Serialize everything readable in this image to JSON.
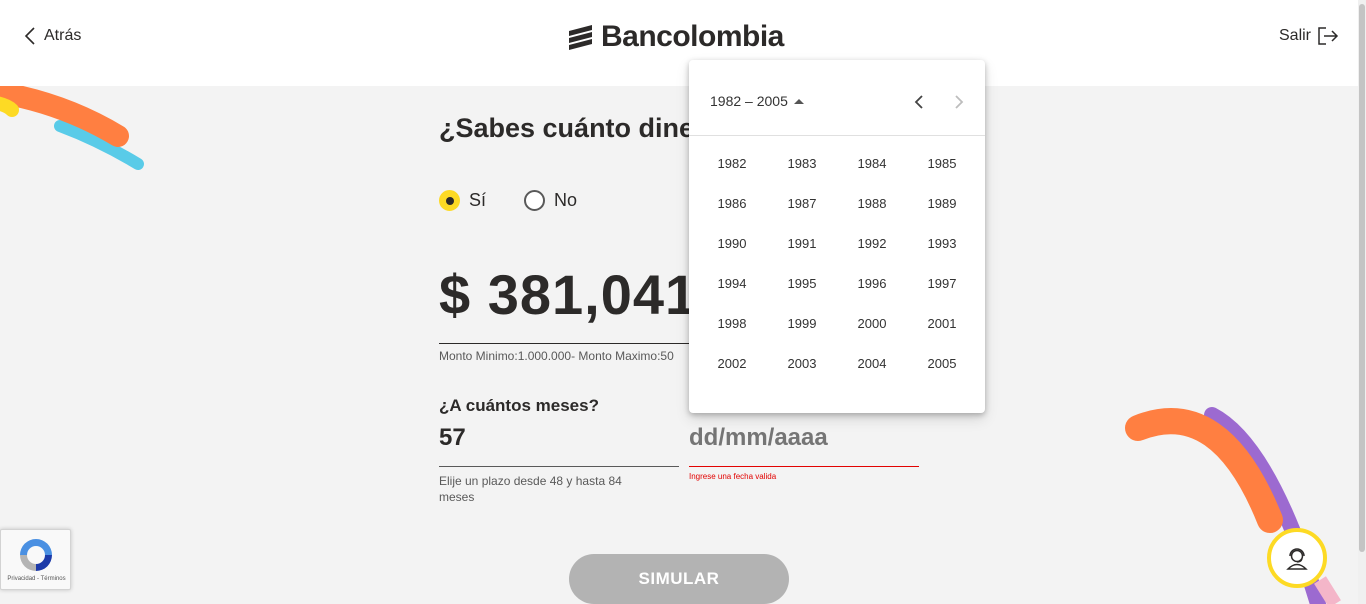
{
  "header": {
    "back_label": "Atrás",
    "brand": "Bancolombia",
    "exit_label": "Salir"
  },
  "main": {
    "question": "¿Sabes cuánto dine",
    "radios": {
      "yes": "Sí",
      "no": "No",
      "selected": "Sí"
    },
    "amount": "$ 381,041,",
    "amount_hint": "Monto Minimo:1.000.000- Monto Maximo:50",
    "months_label": "¿A cuántos meses?",
    "months_value": "57",
    "months_hint": "Elije un plazo desde 48 y hasta 84 meses",
    "date_placeholder": "dd/mm/aaaa",
    "date_error": "Ingrese una fecha valida",
    "simulate_label": "SIMULAR"
  },
  "calendar": {
    "period": "1982 – 2005",
    "years": [
      "1982",
      "1983",
      "1984",
      "1985",
      "1986",
      "1987",
      "1988",
      "1989",
      "1990",
      "1991",
      "1992",
      "1993",
      "1994",
      "1995",
      "1996",
      "1997",
      "1998",
      "1999",
      "2000",
      "2001",
      "2002",
      "2003",
      "2004",
      "2005"
    ]
  },
  "recaptcha": {
    "text": "Privacidad - Términos"
  },
  "colors": {
    "brand_yellow": "#fdda24",
    "error_red": "#e20201",
    "button_gray": "#b3b3b3",
    "text_dark": "#2c2a29"
  },
  "icons": {
    "back": "chevron-left-icon",
    "exit": "logout-icon",
    "chat": "support-agent-icon",
    "recaptcha": "recaptcha-icon"
  }
}
